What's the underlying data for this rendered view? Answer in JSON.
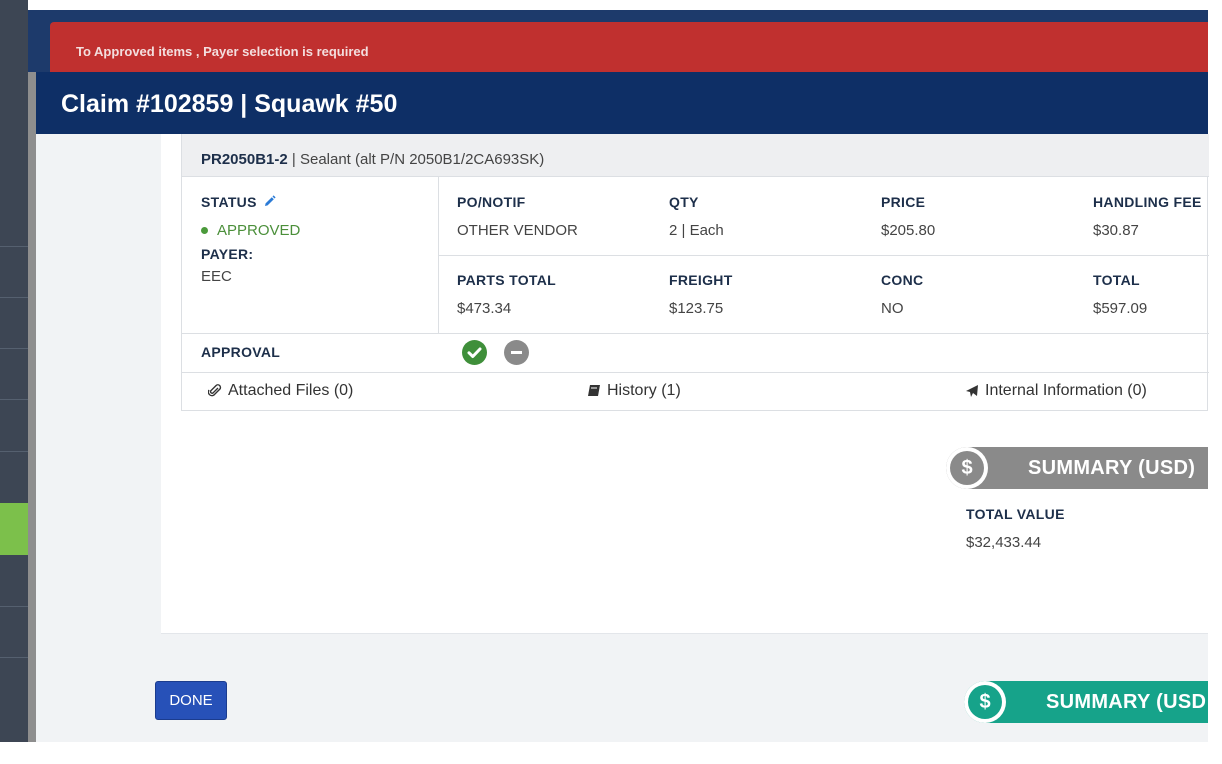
{
  "alert": {
    "message": "To Approved items , Payer selection is required"
  },
  "modal": {
    "title": "Claim #102859 | Squawk #50"
  },
  "part": {
    "number": "PR2050B1-2",
    "separator": "|",
    "description": "Sealant (alt P/N 2050B1/2CA693SK)",
    "status_label": "STATUS",
    "status_value": "APPROVED",
    "payer_label": "PAYER:",
    "payer_value": "EEC",
    "fields_row1": [
      {
        "label": "PO/NOTIF",
        "value": "OTHER VENDOR"
      },
      {
        "label": "QTY",
        "value": "2 | Each"
      },
      {
        "label": "PRICE",
        "value": "$205.80"
      },
      {
        "label": "HANDLING FEE",
        "value": "$30.87"
      }
    ],
    "fields_row2": [
      {
        "label": "PARTS TOTAL",
        "value": "$473.34"
      },
      {
        "label": "FREIGHT",
        "value": "$123.75"
      },
      {
        "label": "CONC",
        "value": "NO"
      },
      {
        "label": "TOTAL",
        "value": "$597.09"
      }
    ],
    "approval_label": "APPROVAL",
    "approve_icon": "check-circle-icon",
    "reject_icon": "minus-circle-icon",
    "colors": {
      "approve": "#3f8f3a",
      "reject": "#8a8a8a"
    }
  },
  "tabs": [
    {
      "label": "Attached Files (0)",
      "icon": "paperclip-icon"
    },
    {
      "label": "History (1)",
      "icon": "book-icon"
    },
    {
      "label": "Internal Information (0)",
      "icon": "plane-icon"
    }
  ],
  "summary_card": {
    "title": "SUMMARY (USD)",
    "total_label": "TOTAL VALUE",
    "total_value": "$32,433.44",
    "color": "#8a8a8a"
  },
  "summary_bottom": {
    "title": "SUMMARY (USD",
    "color": "#16a38a"
  },
  "done_label": "DONE",
  "colors": {
    "alert": "#c0302f",
    "header": "#0e2f66",
    "done": "#2751b8",
    "sidebar_active": "#7cc04b"
  }
}
